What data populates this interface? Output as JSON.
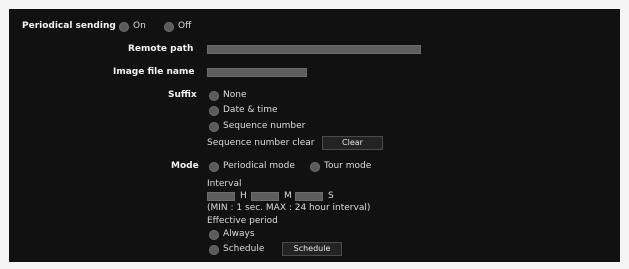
{
  "periodical_sending": {
    "label": "Periodical sending",
    "on_label": "On",
    "off_label": "Off"
  },
  "remote_path": {
    "label": "Remote path",
    "value": ""
  },
  "image_file_name": {
    "label": "Image file name",
    "value": ""
  },
  "suffix": {
    "label": "Suffix",
    "options": [
      "None",
      "Date & time",
      "Sequence number"
    ],
    "seq_clear_label": "Sequence number clear",
    "clear_button": "Clear"
  },
  "mode": {
    "label": "Mode",
    "periodical_label": "Periodical mode",
    "tour_label": "Tour mode"
  },
  "interval": {
    "label": "Interval",
    "h_unit": "H",
    "m_unit": "M",
    "s_unit": "S",
    "hint": "(MIN : 1 sec. MAX : 24 hour interval)",
    "hours_value": "",
    "minutes_value": "",
    "seconds_value": ""
  },
  "effective_period": {
    "label": "Effective period",
    "always_label": "Always",
    "schedule_label": "Schedule",
    "schedule_button": "Schedule"
  }
}
